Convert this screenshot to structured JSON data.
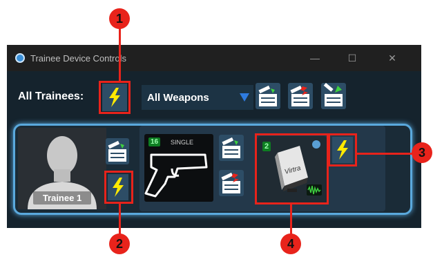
{
  "window": {
    "title": "Trainee Device Controls",
    "controls": {
      "minimize": "—",
      "maximize": "☐",
      "close": "✕"
    }
  },
  "toolbar": {
    "all_trainees_label": "All Trainees:",
    "weapon_select_value": "All Weapons"
  },
  "trainee": {
    "name": "Trainee 1",
    "weapon": {
      "ammo_count": "16",
      "fire_mode": "SINGLE"
    },
    "device": {
      "badge": "2",
      "brand": "Virtra"
    }
  },
  "callouts": [
    "1",
    "2",
    "3",
    "4"
  ],
  "icons": {
    "bolt": "lightning-bolt-icon",
    "arm_all": "arm-all-icon",
    "disarm_all": "disarm-all-icon",
    "reset_all": "reset-all-icon"
  },
  "colors": {
    "accent_red": "#e8231b",
    "tile_blue": "#2d4d66",
    "bolt_yellow": "#ffea00",
    "panel_glow": "#5aa9dd",
    "badge_green": "#0e7d22"
  }
}
